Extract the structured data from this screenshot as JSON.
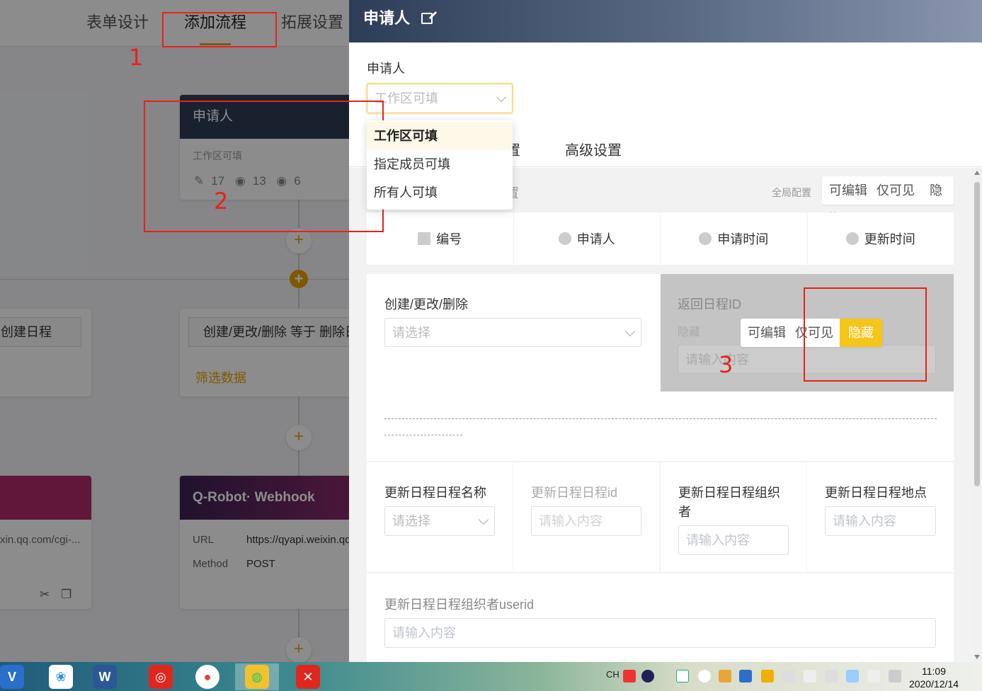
{
  "background": {
    "nav_tabs": [
      "表单设计",
      "添加流程",
      "拓展设置"
    ],
    "applicant_card": {
      "title": "申请人",
      "subtitle": "工作区可填",
      "stats": [
        "17",
        "13",
        "6"
      ]
    },
    "left_filter_text": "创建日程",
    "filter_box_text": "创建/更改/删除 等于 删除日",
    "filter_link": "筛选数据",
    "webhook_card": {
      "title": "Q-Robot· Webhook",
      "url_label": "URL",
      "url_value": "https://qyapi.weixin.qq",
      "method_label": "Method",
      "method_value": "POST"
    },
    "left_card_url": "xin.qq.com/cgi-...",
    "annotations": [
      "1",
      "2",
      "3"
    ]
  },
  "drawer": {
    "title": "申请人",
    "field_label": "申请人",
    "select_value": "工作区可填",
    "dropdown_options": [
      "工作区可填",
      "指定成员可填",
      "所有人可填"
    ],
    "tabs": [
      "置",
      "高级设置"
    ],
    "config_title": "置",
    "global_config": "全局配置",
    "perm_options": [
      "可编辑",
      "仅可见",
      "隐藏"
    ],
    "system_fields": [
      "编号",
      "申请人",
      "申请时间",
      "更新时间"
    ],
    "field1": {
      "label": "创建/更改/删除",
      "placeholder": "请选择"
    },
    "field2": {
      "label": "返回日程ID",
      "hidden_label": "隐藏",
      "placeholder": "请输入内容"
    },
    "field3": {
      "label": "更新日程日程名称",
      "placeholder": "请选择"
    },
    "field4": {
      "label": "更新日程日程id",
      "placeholder": "请输入内容"
    },
    "field5": {
      "label_line1": "更新日程日程组织",
      "label_line2": "者",
      "placeholder": "请输入内容"
    },
    "field6": {
      "label": "更新日程日程地点",
      "placeholder": "请输入内容"
    },
    "field7": {
      "label": "更新日程日程组织者userid",
      "placeholder": "请输入内容"
    }
  },
  "taskbar": {
    "lang": "CH",
    "time": "11:09",
    "date": "2020/12/14"
  }
}
